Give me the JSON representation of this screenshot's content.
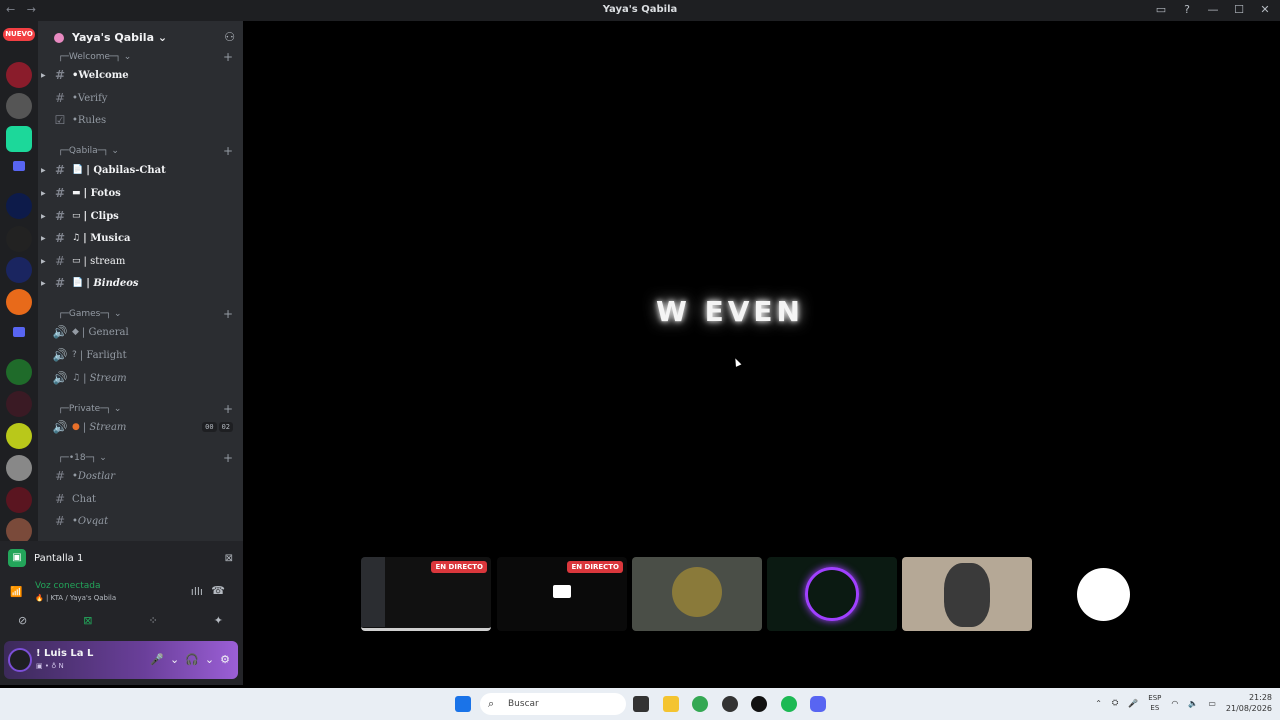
{
  "window": {
    "title": "Yaya's Qabila",
    "nav": "← →"
  },
  "window_controls": {
    "inbox_icon": "inbox-icon",
    "help_icon": "help-icon",
    "minimize": "—",
    "maximize": "☐",
    "close": "✕"
  },
  "guilds": {
    "new_badge": "NUEVO"
  },
  "server": {
    "name": "Yaya's Qabila ⌄",
    "add_member_icon": "add-member-icon"
  },
  "categories": {
    "welcome": "Welcome",
    "qabila": "Qabila",
    "games": "Games",
    "private": "Private",
    "adult": "18"
  },
  "channels": {
    "welcome": "•Welcome",
    "verify": "•Verify",
    "rules": "•Rules",
    "qabilas_chat": "| Qabilas-Chat",
    "fotos": "| Fotos",
    "clips": "| Clips",
    "musica": "| Musica",
    "stream": "| stream",
    "bindeos": "| Bindeos",
    "general": "| General",
    "farlight": "| Farlight",
    "stream_games": "| Stream",
    "stream_private": "| Stream",
    "dostlar": "•Dostlar",
    "chat": "Chat",
    "ovqat": "•Ovqat"
  },
  "private_badges": [
    "00",
    "02"
  ],
  "panel": {
    "screen_share": "Pantalla 1",
    "voice_status": "Voz conectada",
    "voice_location": "🔥 | KTA / Yaya's Qabila",
    "user_name": "! Luis La L",
    "user_status": "▣ • ♁ N"
  },
  "stage": {
    "glow_text": "W EVEN",
    "tiles": [
      {
        "live": "EN DIRECTO"
      },
      {
        "live": "EN DIRECTO"
      }
    ]
  },
  "taskbar": {
    "search_placeholder": "Buscar",
    "lang_top": "ESP",
    "lang_bottom": "ES",
    "time": "21:28",
    "date": "21/08/2026"
  },
  "colors": {
    "accent": "#5865f2",
    "live": "#da373c",
    "voice": "#23a55a",
    "purple": "#9b5fd6"
  }
}
